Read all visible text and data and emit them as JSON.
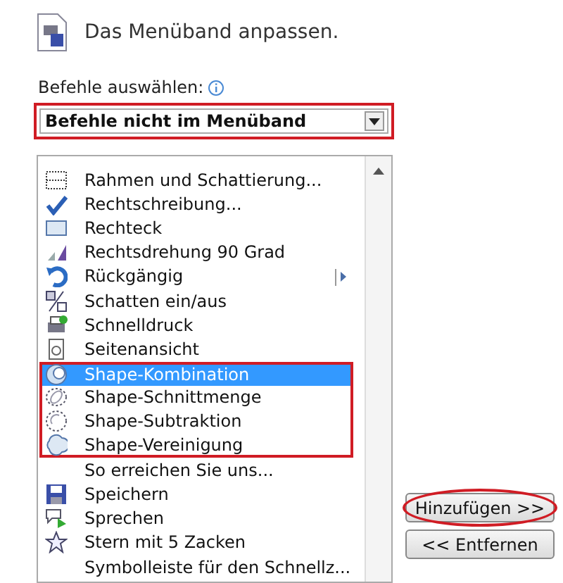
{
  "header": {
    "title": "Das Menüband anpassen."
  },
  "commands": {
    "label": "Befehle auswählen:",
    "dropdown": {
      "value": "Befehle nicht im Menüband",
      "marked": true
    }
  },
  "list": {
    "items": [
      {
        "label": "Rahmen und Schattierung...",
        "selected": false,
        "submenu": false,
        "marked": false
      },
      {
        "label": "Rechtschreibung...",
        "selected": false,
        "submenu": false,
        "marked": false
      },
      {
        "label": "Rechteck",
        "selected": false,
        "submenu": false,
        "marked": false
      },
      {
        "label": "Rechtsdrehung 90 Grad",
        "selected": false,
        "submenu": false,
        "marked": false
      },
      {
        "label": "Rückgängig",
        "selected": false,
        "submenu": true,
        "marked": false
      },
      {
        "label": "Schatten ein/aus",
        "selected": false,
        "submenu": false,
        "marked": false
      },
      {
        "label": "Schnelldruck",
        "selected": false,
        "submenu": false,
        "marked": false
      },
      {
        "label": "Seitenansicht",
        "selected": false,
        "submenu": false,
        "marked": false
      },
      {
        "label": "Shape-Kombination",
        "selected": true,
        "submenu": false,
        "marked": true
      },
      {
        "label": "Shape-Schnittmenge",
        "selected": false,
        "submenu": false,
        "marked": true
      },
      {
        "label": "Shape-Subtraktion",
        "selected": false,
        "submenu": false,
        "marked": true
      },
      {
        "label": "Shape-Vereinigung",
        "selected": false,
        "submenu": false,
        "marked": true
      },
      {
        "label": "So erreichen Sie uns...",
        "selected": false,
        "submenu": false,
        "marked": false
      },
      {
        "label": "Speichern",
        "selected": false,
        "submenu": false,
        "marked": false
      },
      {
        "label": "Sprechen",
        "selected": false,
        "submenu": false,
        "marked": false
      },
      {
        "label": "Stern mit 5 Zacken",
        "selected": false,
        "submenu": false,
        "marked": false
      },
      {
        "label": "Symbolleiste für den Schnellz...",
        "selected": false,
        "submenu": false,
        "marked": false
      }
    ]
  },
  "buttons": [
    {
      "label": "Hinzufügen >>",
      "marked": true
    },
    {
      "label": "<< Entfernen",
      "marked": false
    }
  ]
}
